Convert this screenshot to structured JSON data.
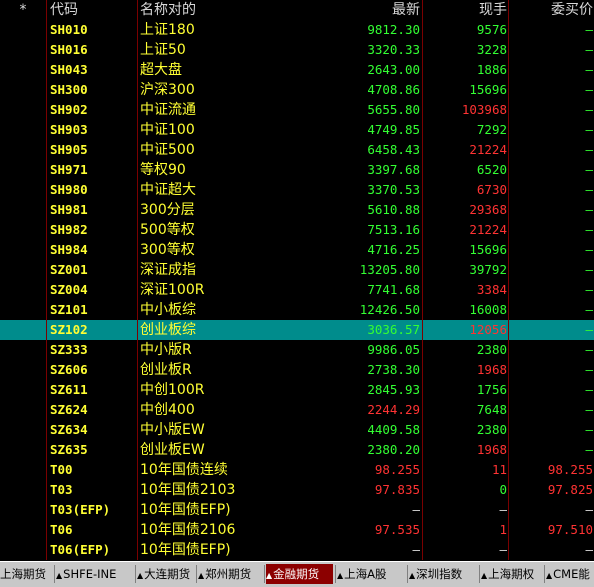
{
  "header": {
    "star": "*",
    "code": "代码",
    "name": "名称对的",
    "latest": "最新",
    "volume": "现手",
    "bid": "委买价"
  },
  "rows": [
    {
      "code": "SH010",
      "name": "上证180",
      "latest": "9812.30",
      "volume": "9576",
      "bid": "—",
      "latest_color": "g",
      "vol_color": "g"
    },
    {
      "code": "SH016",
      "name": "上证50",
      "latest": "3320.33",
      "volume": "3228",
      "bid": "—",
      "latest_color": "g",
      "vol_color": "g"
    },
    {
      "code": "SH043",
      "name": "超大盘",
      "latest": "2643.00",
      "volume": "1886",
      "bid": "—",
      "latest_color": "g",
      "vol_color": "g"
    },
    {
      "code": "SH300",
      "name": "沪深300",
      "latest": "4708.86",
      "volume": "15696",
      "bid": "—",
      "latest_color": "g",
      "vol_color": "g"
    },
    {
      "code": "SH902",
      "name": "中证流通",
      "latest": "5655.80",
      "volume": "103968",
      "bid": "—",
      "latest_color": "g",
      "vol_color": "r"
    },
    {
      "code": "SH903",
      "name": "中证100",
      "latest": "4749.85",
      "volume": "7292",
      "bid": "—",
      "latest_color": "g",
      "vol_color": "g"
    },
    {
      "code": "SH905",
      "name": "中证500",
      "latest": "6458.43",
      "volume": "21224",
      "bid": "—",
      "latest_color": "g",
      "vol_color": "r"
    },
    {
      "code": "SH971",
      "name": "等权90",
      "latest": "3397.68",
      "volume": "6520",
      "bid": "—",
      "latest_color": "g",
      "vol_color": "g"
    },
    {
      "code": "SH980",
      "name": "中证超大",
      "latest": "3370.53",
      "volume": "6730",
      "bid": "—",
      "latest_color": "g",
      "vol_color": "r"
    },
    {
      "code": "SH981",
      "name": "300分层",
      "latest": "5610.88",
      "volume": "29368",
      "bid": "—",
      "latest_color": "g",
      "vol_color": "r"
    },
    {
      "code": "SH982",
      "name": "500等权",
      "latest": "7513.16",
      "volume": "21224",
      "bid": "—",
      "latest_color": "g",
      "vol_color": "r"
    },
    {
      "code": "SH984",
      "name": "300等权",
      "latest": "4716.25",
      "volume": "15696",
      "bid": "—",
      "latest_color": "g",
      "vol_color": "g"
    },
    {
      "code": "SZ001",
      "name": "深证成指",
      "latest": "13205.80",
      "volume": "39792",
      "bid": "—",
      "latest_color": "g",
      "vol_color": "g"
    },
    {
      "code": "SZ004",
      "name": "深证100R",
      "latest": "7741.68",
      "volume": "3384",
      "bid": "—",
      "latest_color": "g",
      "vol_color": "r"
    },
    {
      "code": "SZ101",
      "name": "中小板综",
      "latest": "12426.50",
      "volume": "16008",
      "bid": "—",
      "latest_color": "g",
      "vol_color": "g"
    },
    {
      "code": "SZ102",
      "name": "创业板综",
      "latest": "3036.57",
      "volume": "12056",
      "bid": "—",
      "latest_color": "g",
      "vol_color": "r",
      "selected": true
    },
    {
      "code": "SZ333",
      "name": "中小版R",
      "latest": "9986.05",
      "volume": "2380",
      "bid": "—",
      "latest_color": "g",
      "vol_color": "g"
    },
    {
      "code": "SZ606",
      "name": "创业板R",
      "latest": "2738.30",
      "volume": "1968",
      "bid": "—",
      "latest_color": "g",
      "vol_color": "r"
    },
    {
      "code": "SZ611",
      "name": "中创100R",
      "latest": "2845.93",
      "volume": "1756",
      "bid": "—",
      "latest_color": "g",
      "vol_color": "g"
    },
    {
      "code": "SZ624",
      "name": "中创400",
      "latest": "2244.29",
      "volume": "7648",
      "bid": "—",
      "latest_color": "r",
      "vol_color": "g"
    },
    {
      "code": "SZ634",
      "name": "中小版EW",
      "latest": "4409.58",
      "volume": "2380",
      "bid": "—",
      "latest_color": "g",
      "vol_color": "g"
    },
    {
      "code": "SZ635",
      "name": "创业板EW",
      "latest": "2380.20",
      "volume": "1968",
      "bid": "—",
      "latest_color": "g",
      "vol_color": "r"
    },
    {
      "code": "T00",
      "name": "10年国债连续",
      "latest": "98.255",
      "volume": "11",
      "bid": "98.255",
      "latest_color": "r",
      "vol_color": "r",
      "bid_color": "r"
    },
    {
      "code": "T03",
      "name": "10年国债2103",
      "latest": "97.835",
      "volume": "0",
      "bid": "97.825",
      "latest_color": "r",
      "vol_color": "g",
      "bid_color": "r"
    },
    {
      "code": "T03(EFP)",
      "name": "10年国债EFP)",
      "latest": "—",
      "volume": "—",
      "bid": "—",
      "latest_color": "w",
      "vol_color": "w",
      "bid_color": "w"
    },
    {
      "code": "T06",
      "name": "10年国债2106",
      "latest": "97.535",
      "volume": "1",
      "bid": "97.510",
      "latest_color": "r",
      "vol_color": "r",
      "bid_color": "r"
    },
    {
      "code": "T06(EFP)",
      "name": "10年国债EFP)",
      "latest": "—",
      "volume": "—",
      "bid": "—",
      "latest_color": "w",
      "vol_color": "w",
      "bid_color": "w"
    }
  ],
  "tabs": [
    {
      "label": "上海期货",
      "tri": ""
    },
    {
      "label": "SHFE-INE",
      "tri": "▲"
    },
    {
      "label": "大连期货",
      "tri": "▲"
    },
    {
      "label": "郑州期货",
      "tri": "▲"
    },
    {
      "label": "金融期货",
      "tri": "▲",
      "active": true
    },
    {
      "label": "上海A股",
      "tri": "▲"
    },
    {
      "label": "深圳指数",
      "tri": "▲"
    },
    {
      "label": "上海期权",
      "tri": "▲"
    },
    {
      "label": "CME能",
      "tri": "▲"
    }
  ],
  "colors": {
    "background": "#000000",
    "code_text": "#ffff33",
    "up": "#ff3333",
    "down": "#33ff33",
    "selected_row": "#008c8c",
    "active_tab": "#8c0000"
  }
}
